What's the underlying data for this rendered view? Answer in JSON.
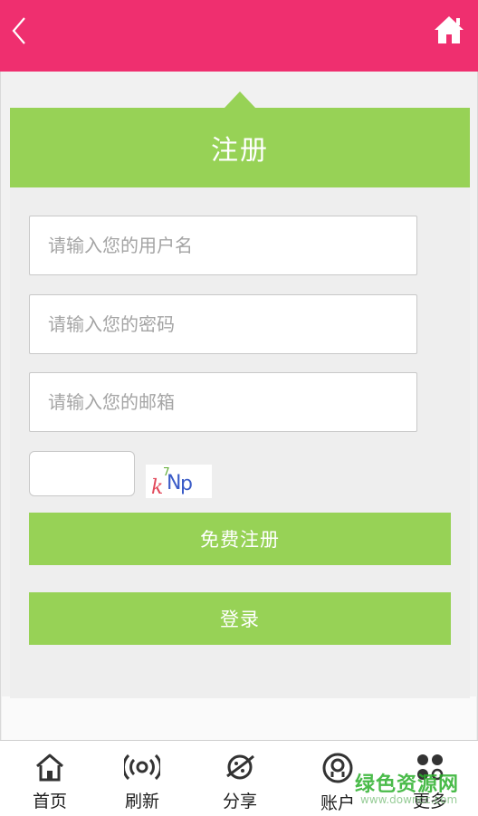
{
  "header": {
    "back_icon": "chevron-left-icon",
    "home_icon": "home-icon",
    "color": "#ef2f6f"
  },
  "form": {
    "title": "注册",
    "username_placeholder": "请输入您的用户名",
    "password_placeholder": "请输入您的密码",
    "email_placeholder": "请输入您的邮箱",
    "captcha_text": "kNp",
    "register_label": "免费注册",
    "login_label": "登录",
    "accent": "#97d256"
  },
  "tabbar": {
    "items": [
      {
        "label": "首页",
        "icon": "home-outline-icon"
      },
      {
        "label": "刷新",
        "icon": "broadcast-icon"
      },
      {
        "label": "分享",
        "icon": "planet-icon"
      },
      {
        "label": "账户",
        "icon": "account-icon"
      },
      {
        "label": "更多",
        "icon": "dots-grid-icon"
      }
    ]
  },
  "watermark": {
    "main": "绿色资源网",
    "sub": "www.downcc.com"
  }
}
